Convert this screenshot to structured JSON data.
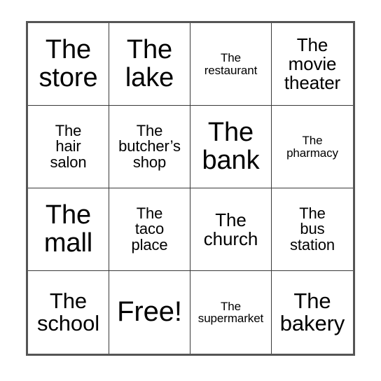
{
  "card": {
    "type": "bingo-card",
    "columns": 4,
    "rows": 4,
    "border_color": "#555555",
    "grid_line_color": "#3a3a3a",
    "background_color": "#ffffff",
    "text_color": "#000000",
    "cells": [
      {
        "text": "The\nstore",
        "size": "lg"
      },
      {
        "text": "The\nlake",
        "size": "lg"
      },
      {
        "text": "The\nrestaurant",
        "size": "xxs"
      },
      {
        "text": "The\nmovie\ntheater",
        "size": "sm"
      },
      {
        "text": "The\nhair\nsalon",
        "size": "xs"
      },
      {
        "text": "The\nbutcher’s\nshop",
        "size": "xs"
      },
      {
        "text": "The\nbank",
        "size": "lg"
      },
      {
        "text": "The\npharmacy",
        "size": "xxs"
      },
      {
        "text": "The\nmall",
        "size": "lg"
      },
      {
        "text": "The\ntaco\nplace",
        "size": "xs"
      },
      {
        "text": "The\nchurch",
        "size": "sm"
      },
      {
        "text": "The\nbus\nstation",
        "size": "xs"
      },
      {
        "text": "The\nschool",
        "size": "md"
      },
      {
        "text": "Free!",
        "size": "xl"
      },
      {
        "text": "The\nsupermarket",
        "size": "xxs"
      },
      {
        "text": "The\nbakery",
        "size": "md"
      }
    ]
  }
}
